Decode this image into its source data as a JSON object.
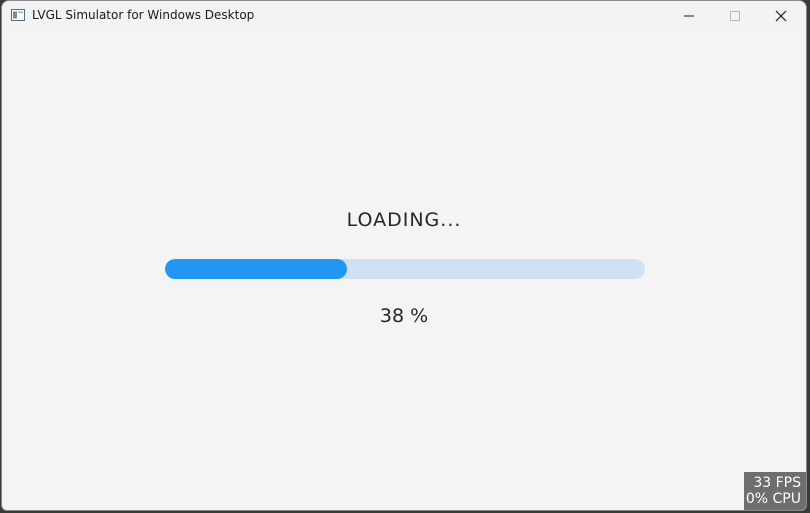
{
  "window": {
    "title": "LVGL Simulator for Windows Desktop",
    "controls": {
      "minimize_icon": "minimize-icon",
      "maximize_icon": "maximize-icon",
      "close_icon": "close-icon"
    }
  },
  "loader": {
    "heading": "LOADING...",
    "progress_fraction": 0.38,
    "percent_text": "38 %",
    "track_color": "#cfe2f4",
    "fill_color": "#2196f3"
  },
  "perf_monitor": {
    "fps": "33 FPS",
    "cpu": "0% CPU"
  }
}
